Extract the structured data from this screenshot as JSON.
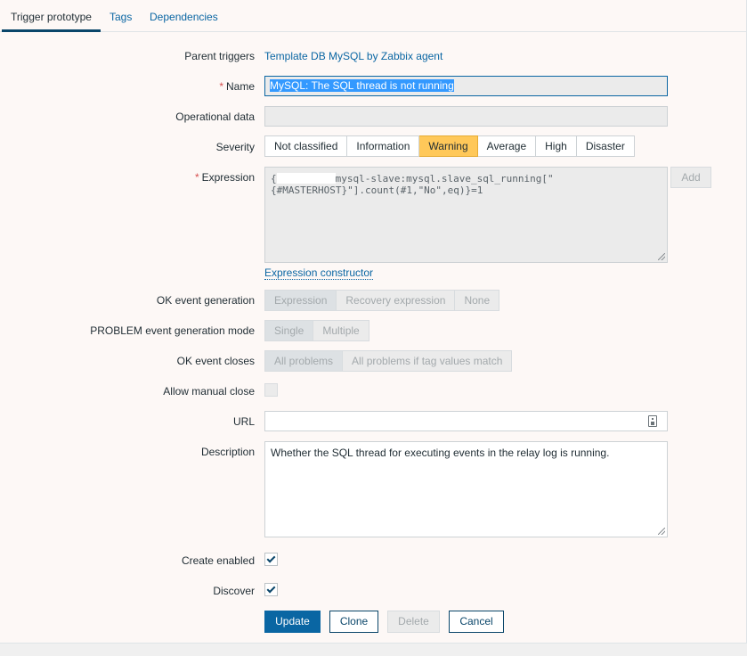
{
  "tabs": [
    {
      "label": "Trigger prototype",
      "active": true
    },
    {
      "label": "Tags",
      "active": false
    },
    {
      "label": "Dependencies",
      "active": false
    }
  ],
  "form": {
    "parent_triggers": {
      "label": "Parent triggers",
      "value": "Template DB MySQL by Zabbix agent"
    },
    "name": {
      "required_mark": "*",
      "label": "Name",
      "value": "MySQL: The SQL thread is not running"
    },
    "operational_data": {
      "label": "Operational data",
      "value": ""
    },
    "severity": {
      "label": "Severity",
      "options": [
        "Not classified",
        "Information",
        "Warning",
        "Average",
        "High",
        "Disaster"
      ],
      "selected": "Warning",
      "selected_color": "#ffc859"
    },
    "expression": {
      "required_mark": "*",
      "label": "Expression",
      "line1_start": "{",
      "line1_rest": "mysql-slave:mysql.slave_sql_running[\"",
      "line2": "{#MASTERHOST}\"].count(#1,\"No\",eq)}=1",
      "add_label": "Add",
      "constructor_link": "Expression constructor"
    },
    "ok_event_generation": {
      "label": "OK event generation",
      "options": [
        "Expression",
        "Recovery expression",
        "None"
      ],
      "selected": "Expression"
    },
    "problem_mode": {
      "label": "PROBLEM event generation mode",
      "options": [
        "Single",
        "Multiple"
      ],
      "selected": "Single"
    },
    "ok_event_closes": {
      "label": "OK event closes",
      "options": [
        "All problems",
        "All problems if tag values match"
      ],
      "selected": "All problems"
    },
    "allow_manual_close": {
      "label": "Allow manual close",
      "checked": false
    },
    "url": {
      "label": "URL",
      "value": ""
    },
    "description": {
      "label": "Description",
      "value": "Whether the SQL thread for executing events in the relay log is running."
    },
    "create_enabled": {
      "label": "Create enabled",
      "checked": true
    },
    "discover": {
      "label": "Discover",
      "checked": true
    }
  },
  "buttons": {
    "update": "Update",
    "clone": "Clone",
    "delete": "Delete",
    "cancel": "Cancel"
  },
  "colors": {
    "accent": "#0a66a3",
    "warning": "#ffc859",
    "required": "#d64e4e",
    "selection": "#3399ff"
  }
}
